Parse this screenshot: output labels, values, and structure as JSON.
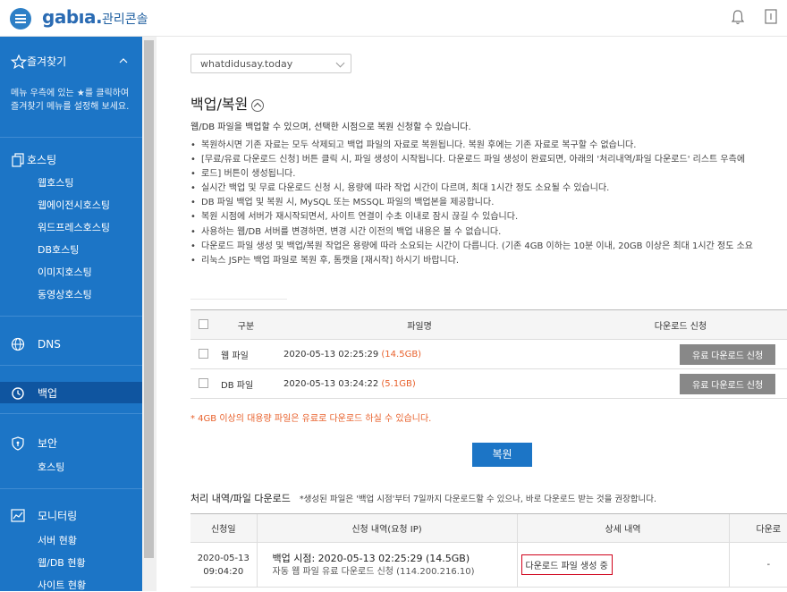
{
  "header": {
    "logo": "gabıa.",
    "title": "관리콘솔"
  },
  "sidebar": {
    "favorites": {
      "label": "즐겨찾기",
      "note": "메뉴 우측에 있는 ★를 클릭하여 즐겨찾기 메뉴를 설정해 보세요."
    },
    "hosting": {
      "label": "호스팅",
      "items": [
        "웹호스팅",
        "웹에이전시호스팅",
        "워드프레스호스팅",
        "DB호스팅",
        "이미지호스팅",
        "동영상호스팅"
      ]
    },
    "dns": {
      "label": "DNS"
    },
    "backup": {
      "label": "백업"
    },
    "security": {
      "label": "보안",
      "items": [
        "호스팅"
      ]
    },
    "monitoring": {
      "label": "모니터링",
      "items": [
        "서버 현황",
        "웹/DB 현황",
        "사이트 현황"
      ]
    }
  },
  "main": {
    "site_select": "whatdidusay.today",
    "title": "백업/복원",
    "intro": "웹/DB 파일을 백업할 수 있으며, 선택한 시점으로 복원 신청할 수 있습니다.",
    "bullets": [
      "복원하시면 기존 자료는 모두 삭제되고 백업 파일의 자료로 복원됩니다. 복원 후에는 기존 자료로 복구할 수 없습니다.",
      "[무료/유료 다운로드 신청] 버튼 클릭 시, 파일 생성이 시작됩니다. 다운로드 파일 생성이 완료되면, 아래의 '처리내역/파일 다운로드' 리스트 우측에",
      "로드] 버튼이 생성됩니다.",
      "실시간 백업 및 무료 다운로드 신청 시, 용량에 따라 작업 시간이 다르며, 최대 1시간 정도 소요될 수 있습니다.",
      "DB 파일 백업 및 복원 시, MySQL 또는 MSSQL 파일의 백업본을 제공합니다.",
      "복원 시점에 서버가 재시작되면서, 사이트 연결이 수초 이내로 잠시 끊길 수 있습니다.",
      "사용하는 웹/DB 서버를 변경하면, 변경 시간 이전의 백업 내용은 볼 수 없습니다.",
      "다운로드 파일 생성 및 백업/복원 작업은 용량에 따라 소요되는 시간이 다릅니다. (기존 4GB 이하는 10분 이내, 20GB 이상은 최대 1시간 정도 소요",
      "리눅스 JSP는 백업 파일로 복원 후, 톰캣을 [재시작] 하시기 바랍니다."
    ],
    "file_table": {
      "headers": [
        "구분",
        "파일명",
        "다운로드 신청"
      ],
      "rows": [
        {
          "type": "웹 파일",
          "date": "2020-05-13 02:25:29",
          "size": "(14.5GB)",
          "button": "유료 다운로드 신청"
        },
        {
          "type": "DB 파일",
          "date": "2020-05-13 03:24:22",
          "size": "(5.1GB)",
          "button": "유료 다운로드 신청"
        }
      ]
    },
    "note": "* 4GB 이상의 대용량 파일은 유료로 다운로드 하실 수 있습니다.",
    "restore_button": "복원",
    "history_title": "처리 내역/파일 다운로드",
    "history_note": "*생성된 파일은 '백업 시점'부터 7일까지 다운로드할 수 있으나, 바로 다운로드 받는 것을 권장합니다.",
    "history_table": {
      "headers": [
        "신청일",
        "신청 내역(요청 IP)",
        "상세 내역",
        "다운로"
      ],
      "rows": [
        {
          "date": "2020-05-13",
          "time": "09:04:20",
          "line1": "백업 시점:  2020-05-13 02:25:29 (14.5GB)",
          "line2": "자동 웹 파일 유료 다운로드 신청 (114.200.216.10)",
          "detail": "다운로드 파일 생성 중",
          "download": "-"
        }
      ]
    }
  }
}
